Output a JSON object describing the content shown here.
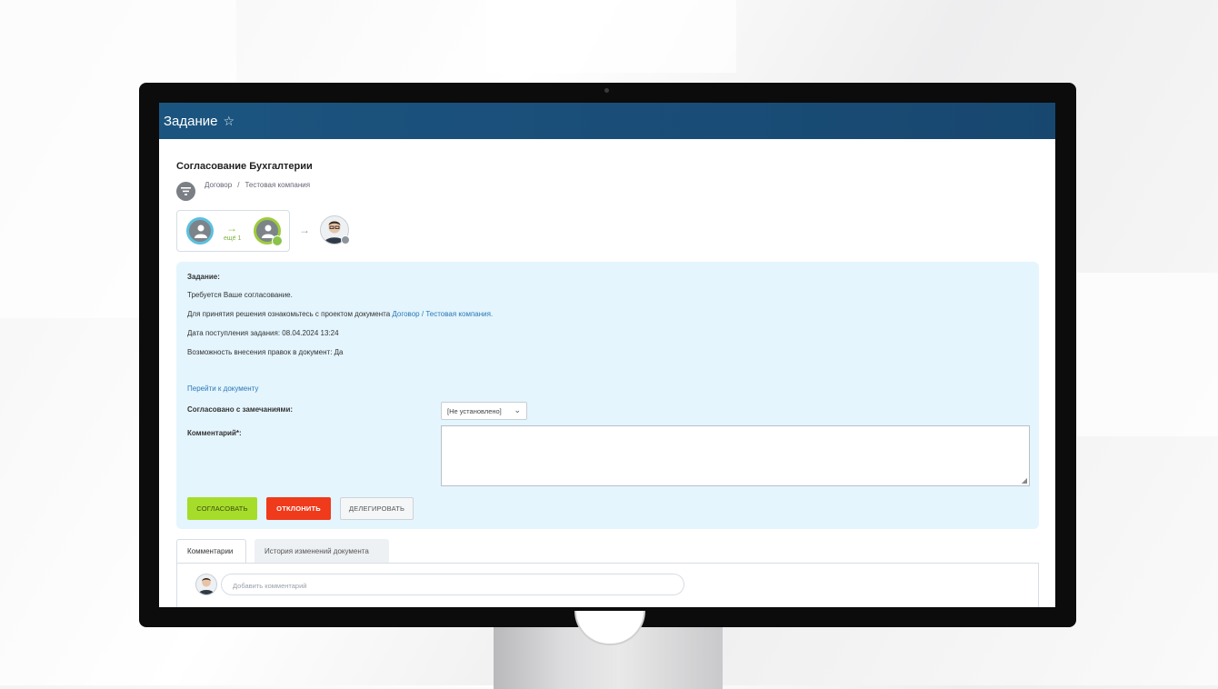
{
  "window": {
    "title": "Задание"
  },
  "task": {
    "title": "Согласование Бухгалтерии",
    "breadcrumb": [
      "Договор",
      "Тестовая компания"
    ],
    "breadcrumb_sep": "/"
  },
  "route": {
    "more_label": "ещё 1"
  },
  "panel": {
    "heading": "Задание:",
    "line1": "Требуется Ваше согласование.",
    "line2_prefix": "Для принятия решения ознакомьтесь с проектом документа",
    "line2_link1": "Договор",
    "line2_sep": "/",
    "line2_link2": "Тестовая компания.",
    "line3": "Дата поступления задания: 08.04.2024 13:24",
    "line4": "Возможность внесения правок в документ: Да",
    "goto_link": "Перейти к документу",
    "remarks_label": "Согласовано с замечаниями:",
    "remarks_value": "[Не установлено]",
    "comment_label": "Комментарий*:",
    "approve_label": "СОГЛАСОВАТЬ",
    "reject_label": "ОТКЛОНИТЬ",
    "delegate_label": "ДЕЛЕГИРОВАТЬ"
  },
  "tabs": [
    {
      "label": "Комментарии",
      "active": true
    },
    {
      "label": "История изменений документа",
      "active": false
    }
  ],
  "comments": {
    "placeholder": "Добавить комментарий"
  },
  "colors": {
    "topbar": "#1b557f",
    "panel_bg": "#e4f5fd",
    "approve": "#a6dd2a",
    "reject": "#f03a1c",
    "link": "#2a78b8"
  },
  "icons": [
    "star-icon",
    "filter-icon",
    "user-icon",
    "check-icon",
    "arrow-right-icon",
    "clock-icon",
    "chevron-down-icon",
    "resize-icon"
  ]
}
